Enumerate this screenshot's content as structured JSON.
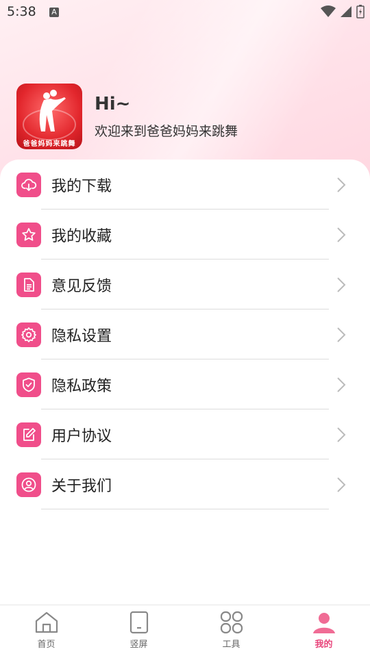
{
  "status_bar": {
    "time": "5:38",
    "notification_badge": "A"
  },
  "profile": {
    "greeting": "Hi~",
    "welcome": "欢迎来到爸爸妈妈来跳舞",
    "avatar_caption": "爸爸妈妈来跳舞"
  },
  "menu": [
    {
      "label": "我的下载",
      "icon": "cloud-download-icon"
    },
    {
      "label": "我的收藏",
      "icon": "star-icon"
    },
    {
      "label": "意见反馈",
      "icon": "document-icon"
    },
    {
      "label": "隐私设置",
      "icon": "gear-icon"
    },
    {
      "label": "隐私政策",
      "icon": "shield-check-icon"
    },
    {
      "label": "用户协议",
      "icon": "edit-icon"
    },
    {
      "label": "关于我们",
      "icon": "user-circle-icon"
    }
  ],
  "tabbar": [
    {
      "label": "首页",
      "icon": "home-icon",
      "active": false
    },
    {
      "label": "竖屏",
      "icon": "phone-portrait-icon",
      "active": false
    },
    {
      "label": "工具",
      "icon": "tools-grid-icon",
      "active": false
    },
    {
      "label": "我的",
      "icon": "person-icon",
      "active": true
    }
  ],
  "colors": {
    "accent": "#f04e8a",
    "tab_active": "#e8457b"
  }
}
